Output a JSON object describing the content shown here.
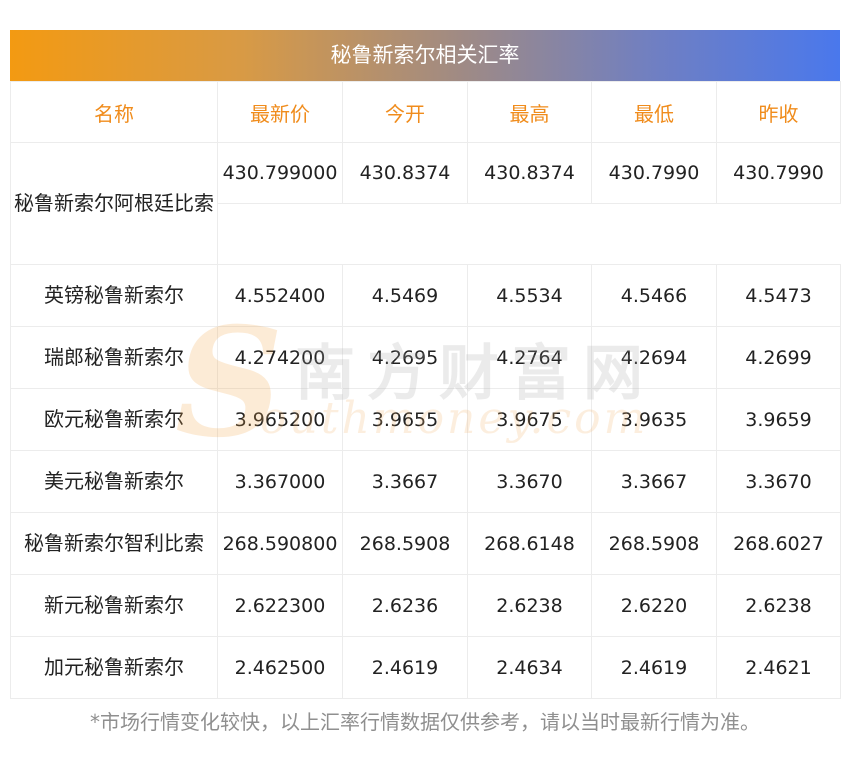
{
  "title": "秘鲁新索尔相关汇率",
  "columns": [
    "名称",
    "最新价",
    "今开",
    "最高",
    "最低",
    "昨收"
  ],
  "rows": [
    {
      "name": "秘鲁新索尔阿根廷比索",
      "latest": "430.799000",
      "open": "430.8374",
      "high": "430.8374",
      "low": "430.7990",
      "prev_close": "430.7990"
    },
    {
      "name": "英镑秘鲁新索尔",
      "latest": "4.552400",
      "open": "4.5469",
      "high": "4.5534",
      "low": "4.5466",
      "prev_close": "4.5473"
    },
    {
      "name": "瑞郎秘鲁新索尔",
      "latest": "4.274200",
      "open": "4.2695",
      "high": "4.2764",
      "low": "4.2694",
      "prev_close": "4.2699"
    },
    {
      "name": "欧元秘鲁新索尔",
      "latest": "3.965200",
      "open": "3.9655",
      "high": "3.9675",
      "low": "3.9635",
      "prev_close": "3.9659"
    },
    {
      "name": "美元秘鲁新索尔",
      "latest": "3.367000",
      "open": "3.3667",
      "high": "3.3670",
      "low": "3.3667",
      "prev_close": "3.3670"
    },
    {
      "name": "秘鲁新索尔智利比索",
      "latest": "268.590800",
      "open": "268.5908",
      "high": "268.6148",
      "low": "268.5908",
      "prev_close": "268.6027"
    },
    {
      "name": "新元秘鲁新索尔",
      "latest": "2.622300",
      "open": "2.6236",
      "high": "2.6238",
      "low": "2.6220",
      "prev_close": "2.6238"
    },
    {
      "name": "加元秘鲁新索尔",
      "latest": "2.462500",
      "open": "2.4619",
      "high": "2.4634",
      "low": "2.4619",
      "prev_close": "2.4621"
    }
  ],
  "watermark": {
    "cn": "南方财富网",
    "en": "outhmoney.com",
    "s": "S"
  },
  "footnote": "*市场行情变化较快，以上汇率行情数据仅供参考，请以当时最新行情为准。",
  "colors": {
    "header_text": "#f08c1c",
    "gradient_start": "#f39a12",
    "gradient_end": "#4a78ec"
  }
}
